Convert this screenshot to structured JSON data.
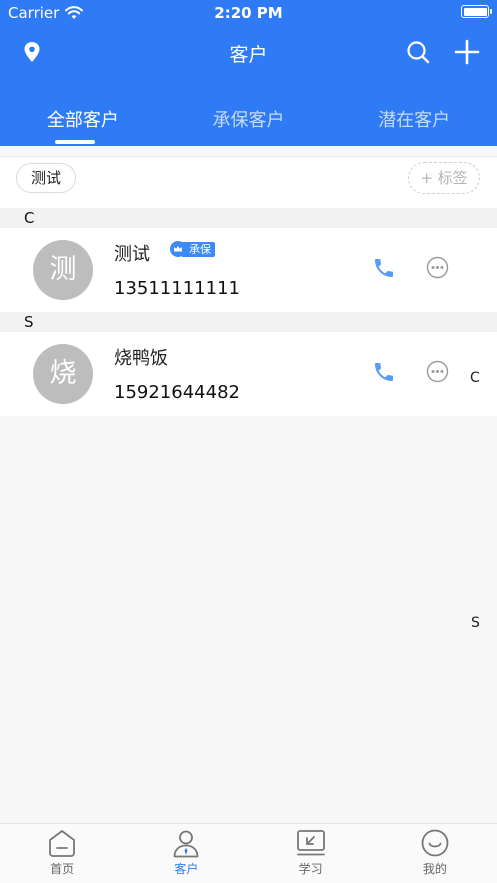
{
  "status_bar": {
    "carrier": "Carrier",
    "time": "2:20 PM"
  },
  "nav": {
    "title": "客户",
    "icons": [
      "location-icon",
      "search-icon",
      "add-icon"
    ]
  },
  "tabs": [
    {
      "label": "全部客户",
      "active": true
    },
    {
      "label": "承保客户",
      "active": false
    },
    {
      "label": "潜在客户",
      "active": false
    }
  ],
  "tags": {
    "chip": "测试",
    "add_label": "+ 标签"
  },
  "sections": [
    {
      "letter": "C",
      "customers": [
        {
          "avatar": "测",
          "name": "测试",
          "badge": "承保",
          "phone": "13511111111"
        }
      ]
    },
    {
      "letter": "S",
      "customers": [
        {
          "avatar": "烧",
          "name": "烧鸭饭",
          "phone": "15921644482"
        }
      ]
    }
  ],
  "index_bar": [
    "C",
    "S"
  ],
  "tabbar": [
    {
      "label": "首页",
      "icon": "home-icon",
      "active": false
    },
    {
      "label": "客户",
      "icon": "person-icon",
      "active": true
    },
    {
      "label": "学习",
      "icon": "learn-icon",
      "active": false
    },
    {
      "label": "我的",
      "icon": "smile-icon",
      "active": false
    }
  ],
  "colors": {
    "primary": "#2f7bf5",
    "avatar": "#bdbdbd",
    "call": "#5b9bf5"
  }
}
